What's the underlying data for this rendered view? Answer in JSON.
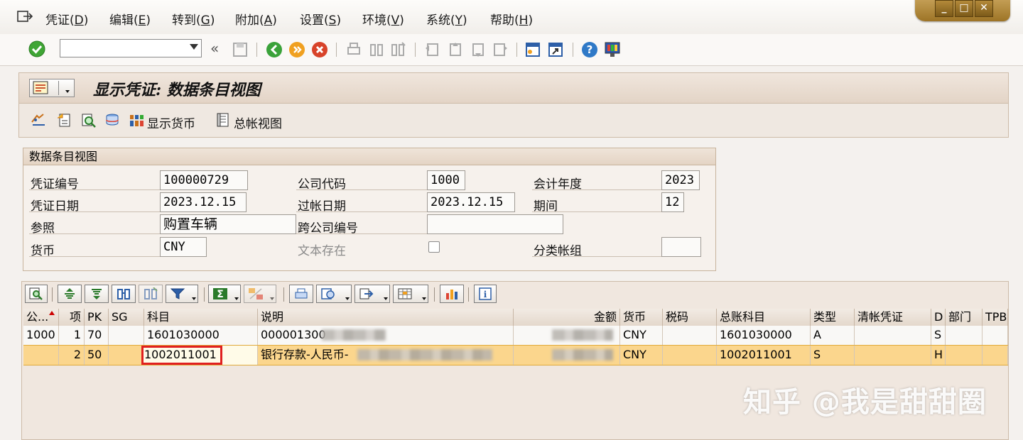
{
  "menu": {
    "items": [
      {
        "label": "凭证",
        "key": "D"
      },
      {
        "label": "编辑",
        "key": "E"
      },
      {
        "label": "转到",
        "key": "G"
      },
      {
        "label": "附加",
        "key": "A"
      },
      {
        "label": "设置",
        "key": "S"
      },
      {
        "label": "环境",
        "key": "V"
      },
      {
        "label": "系统",
        "key": "Y"
      },
      {
        "label": "帮助",
        "key": "H"
      }
    ]
  },
  "title": "显示凭证: 数据条目视图",
  "app_toolbar": {
    "display_currency": "显示货币",
    "general_ledger_view": "总帐视图"
  },
  "header": {
    "group_title": "数据条目视图",
    "doc_number": {
      "label": "凭证编号",
      "value": "100000729"
    },
    "company_code": {
      "label": "公司代码",
      "value": "1000"
    },
    "fiscal_year": {
      "label": "会计年度",
      "value": "2023"
    },
    "doc_date": {
      "label": "凭证日期",
      "value": "2023.12.15"
    },
    "posting_date": {
      "label": "过帐日期",
      "value": "2023.12.15"
    },
    "period": {
      "label": "期间",
      "value": "12"
    },
    "reference": {
      "label": "参照",
      "value": "购置车辆"
    },
    "cross_company": {
      "label": "跨公司编号",
      "value": ""
    },
    "currency": {
      "label": "货币",
      "value": "CNY"
    },
    "text_exists": {
      "label": "文本存在",
      "checked": false
    },
    "ledger_group": {
      "label": "分类帐组",
      "value": ""
    }
  },
  "grid": {
    "columns": [
      "公...",
      "项",
      "PK",
      "SG",
      "科目",
      "说明",
      "金额",
      "货币",
      "税码",
      "总账科目",
      "类型",
      "清帐凭证",
      "D",
      "部门",
      "TPB"
    ],
    "rows": [
      {
        "company": "1000",
        "item": "1",
        "pk": "70",
        "sg": "",
        "account": "1601030000",
        "text": "000001300",
        "amount": "",
        "currency": "CNY",
        "tax": "",
        "gl": "1601030000",
        "type": "A",
        "clearing": "",
        "d": "S",
        "dept": "",
        "tpb": ""
      },
      {
        "company": "",
        "item": "2",
        "pk": "50",
        "sg": "",
        "account": "1002011001",
        "text": "银行存款-人民币-",
        "amount": "",
        "currency": "CNY",
        "tax": "",
        "gl": "1002011001",
        "type": "S",
        "clearing": "",
        "d": "H",
        "dept": "",
        "tpb": ""
      }
    ]
  },
  "watermark": "知乎 @我是甜甜圈",
  "colors": {
    "selected_row": "#fbd68d",
    "highlight_box": "#e02020",
    "title_bg": "#e3d4c6"
  }
}
